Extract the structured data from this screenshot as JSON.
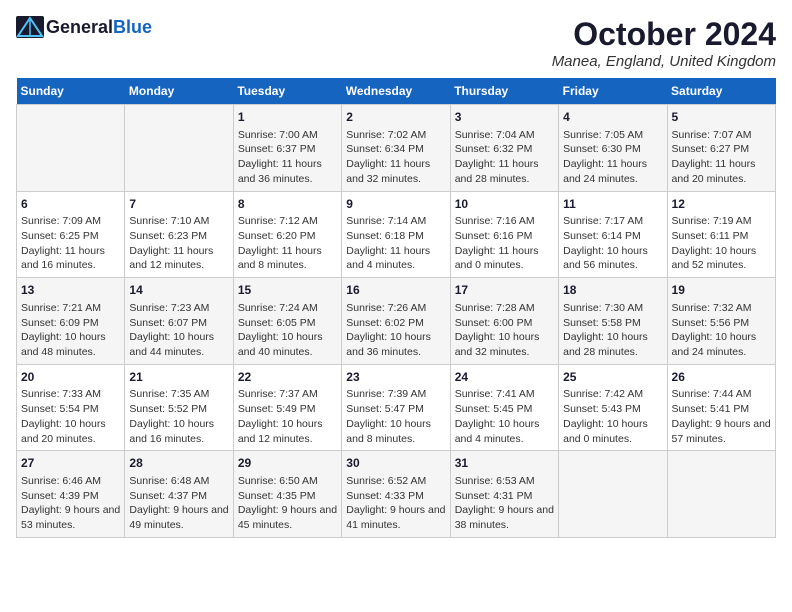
{
  "logo": {
    "general": "General",
    "blue": "Blue"
  },
  "title": "October 2024",
  "location": "Manea, England, United Kingdom",
  "days_of_week": [
    "Sunday",
    "Monday",
    "Tuesday",
    "Wednesday",
    "Thursday",
    "Friday",
    "Saturday"
  ],
  "weeks": [
    [
      {
        "day": "",
        "sunrise": "",
        "sunset": "",
        "daylight": ""
      },
      {
        "day": "",
        "sunrise": "",
        "sunset": "",
        "daylight": ""
      },
      {
        "day": "1",
        "sunrise": "Sunrise: 7:00 AM",
        "sunset": "Sunset: 6:37 PM",
        "daylight": "Daylight: 11 hours and 36 minutes."
      },
      {
        "day": "2",
        "sunrise": "Sunrise: 7:02 AM",
        "sunset": "Sunset: 6:34 PM",
        "daylight": "Daylight: 11 hours and 32 minutes."
      },
      {
        "day": "3",
        "sunrise": "Sunrise: 7:04 AM",
        "sunset": "Sunset: 6:32 PM",
        "daylight": "Daylight: 11 hours and 28 minutes."
      },
      {
        "day": "4",
        "sunrise": "Sunrise: 7:05 AM",
        "sunset": "Sunset: 6:30 PM",
        "daylight": "Daylight: 11 hours and 24 minutes."
      },
      {
        "day": "5",
        "sunrise": "Sunrise: 7:07 AM",
        "sunset": "Sunset: 6:27 PM",
        "daylight": "Daylight: 11 hours and 20 minutes."
      }
    ],
    [
      {
        "day": "6",
        "sunrise": "Sunrise: 7:09 AM",
        "sunset": "Sunset: 6:25 PM",
        "daylight": "Daylight: 11 hours and 16 minutes."
      },
      {
        "day": "7",
        "sunrise": "Sunrise: 7:10 AM",
        "sunset": "Sunset: 6:23 PM",
        "daylight": "Daylight: 11 hours and 12 minutes."
      },
      {
        "day": "8",
        "sunrise": "Sunrise: 7:12 AM",
        "sunset": "Sunset: 6:20 PM",
        "daylight": "Daylight: 11 hours and 8 minutes."
      },
      {
        "day": "9",
        "sunrise": "Sunrise: 7:14 AM",
        "sunset": "Sunset: 6:18 PM",
        "daylight": "Daylight: 11 hours and 4 minutes."
      },
      {
        "day": "10",
        "sunrise": "Sunrise: 7:16 AM",
        "sunset": "Sunset: 6:16 PM",
        "daylight": "Daylight: 11 hours and 0 minutes."
      },
      {
        "day": "11",
        "sunrise": "Sunrise: 7:17 AM",
        "sunset": "Sunset: 6:14 PM",
        "daylight": "Daylight: 10 hours and 56 minutes."
      },
      {
        "day": "12",
        "sunrise": "Sunrise: 7:19 AM",
        "sunset": "Sunset: 6:11 PM",
        "daylight": "Daylight: 10 hours and 52 minutes."
      }
    ],
    [
      {
        "day": "13",
        "sunrise": "Sunrise: 7:21 AM",
        "sunset": "Sunset: 6:09 PM",
        "daylight": "Daylight: 10 hours and 48 minutes."
      },
      {
        "day": "14",
        "sunrise": "Sunrise: 7:23 AM",
        "sunset": "Sunset: 6:07 PM",
        "daylight": "Daylight: 10 hours and 44 minutes."
      },
      {
        "day": "15",
        "sunrise": "Sunrise: 7:24 AM",
        "sunset": "Sunset: 6:05 PM",
        "daylight": "Daylight: 10 hours and 40 minutes."
      },
      {
        "day": "16",
        "sunrise": "Sunrise: 7:26 AM",
        "sunset": "Sunset: 6:02 PM",
        "daylight": "Daylight: 10 hours and 36 minutes."
      },
      {
        "day": "17",
        "sunrise": "Sunrise: 7:28 AM",
        "sunset": "Sunset: 6:00 PM",
        "daylight": "Daylight: 10 hours and 32 minutes."
      },
      {
        "day": "18",
        "sunrise": "Sunrise: 7:30 AM",
        "sunset": "Sunset: 5:58 PM",
        "daylight": "Daylight: 10 hours and 28 minutes."
      },
      {
        "day": "19",
        "sunrise": "Sunrise: 7:32 AM",
        "sunset": "Sunset: 5:56 PM",
        "daylight": "Daylight: 10 hours and 24 minutes."
      }
    ],
    [
      {
        "day": "20",
        "sunrise": "Sunrise: 7:33 AM",
        "sunset": "Sunset: 5:54 PM",
        "daylight": "Daylight: 10 hours and 20 minutes."
      },
      {
        "day": "21",
        "sunrise": "Sunrise: 7:35 AM",
        "sunset": "Sunset: 5:52 PM",
        "daylight": "Daylight: 10 hours and 16 minutes."
      },
      {
        "day": "22",
        "sunrise": "Sunrise: 7:37 AM",
        "sunset": "Sunset: 5:49 PM",
        "daylight": "Daylight: 10 hours and 12 minutes."
      },
      {
        "day": "23",
        "sunrise": "Sunrise: 7:39 AM",
        "sunset": "Sunset: 5:47 PM",
        "daylight": "Daylight: 10 hours and 8 minutes."
      },
      {
        "day": "24",
        "sunrise": "Sunrise: 7:41 AM",
        "sunset": "Sunset: 5:45 PM",
        "daylight": "Daylight: 10 hours and 4 minutes."
      },
      {
        "day": "25",
        "sunrise": "Sunrise: 7:42 AM",
        "sunset": "Sunset: 5:43 PM",
        "daylight": "Daylight: 10 hours and 0 minutes."
      },
      {
        "day": "26",
        "sunrise": "Sunrise: 7:44 AM",
        "sunset": "Sunset: 5:41 PM",
        "daylight": "Daylight: 9 hours and 57 minutes."
      }
    ],
    [
      {
        "day": "27",
        "sunrise": "Sunrise: 6:46 AM",
        "sunset": "Sunset: 4:39 PM",
        "daylight": "Daylight: 9 hours and 53 minutes."
      },
      {
        "day": "28",
        "sunrise": "Sunrise: 6:48 AM",
        "sunset": "Sunset: 4:37 PM",
        "daylight": "Daylight: 9 hours and 49 minutes."
      },
      {
        "day": "29",
        "sunrise": "Sunrise: 6:50 AM",
        "sunset": "Sunset: 4:35 PM",
        "daylight": "Daylight: 9 hours and 45 minutes."
      },
      {
        "day": "30",
        "sunrise": "Sunrise: 6:52 AM",
        "sunset": "Sunset: 4:33 PM",
        "daylight": "Daylight: 9 hours and 41 minutes."
      },
      {
        "day": "31",
        "sunrise": "Sunrise: 6:53 AM",
        "sunset": "Sunset: 4:31 PM",
        "daylight": "Daylight: 9 hours and 38 minutes."
      },
      {
        "day": "",
        "sunrise": "",
        "sunset": "",
        "daylight": ""
      },
      {
        "day": "",
        "sunrise": "",
        "sunset": "",
        "daylight": ""
      }
    ]
  ]
}
